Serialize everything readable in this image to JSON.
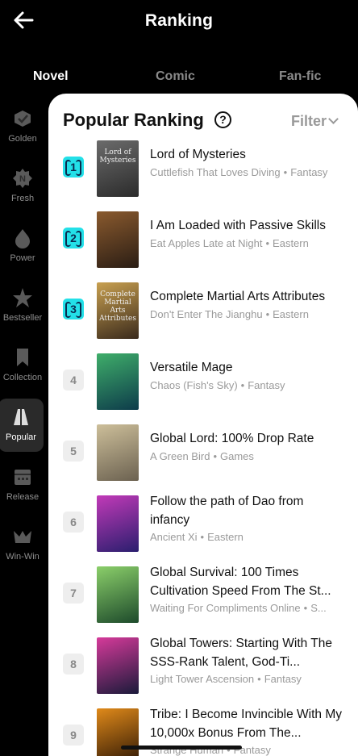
{
  "header": {
    "title": "Ranking"
  },
  "tabs": [
    {
      "label": "Novel",
      "active": true
    },
    {
      "label": "Comic",
      "active": false
    },
    {
      "label": "Fan-fic",
      "active": false
    }
  ],
  "sidebar": {
    "items": [
      {
        "label": "Golden",
        "icon": "golden-icon"
      },
      {
        "label": "Fresh",
        "icon": "fresh-icon"
      },
      {
        "label": "Power",
        "icon": "power-icon"
      },
      {
        "label": "Bestseller",
        "icon": "bestseller-icon"
      },
      {
        "label": "Collection",
        "icon": "collection-icon"
      },
      {
        "label": "Popular",
        "icon": "popular-icon",
        "active": true
      },
      {
        "label": "Release",
        "icon": "release-icon"
      },
      {
        "label": "Win-Win",
        "icon": "win-win-icon"
      }
    ]
  },
  "panel": {
    "title": "Popular Ranking",
    "help_label": "?",
    "filter_label": "Filter"
  },
  "books": [
    {
      "rank": "1",
      "title": "Lord of Mysteries",
      "author": "Cuttlefish That Loves Diving",
      "genre": "Fantasy",
      "cover_text": "Lord of Mysteries",
      "cover_colors": [
        "#2b2b2b",
        "#6b6b6b"
      ]
    },
    {
      "rank": "2",
      "title": "I Am Loaded with Passive Skills",
      "author": "Eat Apples Late at Night",
      "genre": "Eastern",
      "cover_text": "",
      "cover_colors": [
        "#2a1d14",
        "#8a5a2e"
      ]
    },
    {
      "rank": "3",
      "title": "Complete Martial Arts Attributes",
      "author": "Don't Enter The Jianghu",
      "genre": "Eastern",
      "cover_text": "Complete Martial Arts Attributes",
      "cover_colors": [
        "#3a2a1c",
        "#c8a050"
      ]
    },
    {
      "rank": "4",
      "title": "Versatile Mage",
      "author": "Chaos (Fish's Sky)",
      "genre": "Fantasy",
      "cover_text": "",
      "cover_colors": [
        "#0d3b4a",
        "#3fae6a"
      ]
    },
    {
      "rank": "5",
      "title": "Global Lord: 100% Drop Rate",
      "author": "A Green Bird",
      "genre": "Games",
      "cover_text": "",
      "cover_colors": [
        "#6b6150",
        "#cdbf9a"
      ]
    },
    {
      "rank": "6",
      "title": "Follow the path of Dao from infancy",
      "author": "Ancient Xi",
      "genre": "Eastern",
      "cover_text": "",
      "cover_colors": [
        "#2a1e6e",
        "#c23ab8"
      ]
    },
    {
      "rank": "7",
      "title": "Global Survival: 100 Times Cultivation Speed From The St...",
      "author": "Waiting For Compliments Online",
      "genre": "S...",
      "cover_text": "",
      "cover_colors": [
        "#1d4a2b",
        "#8bcf6a"
      ]
    },
    {
      "rank": "8",
      "title": "Global Towers: Starting With The SSS-Rank Talent, God-Ti...",
      "author": "Light Tower Ascension",
      "genre": "Fantasy",
      "cover_text": "",
      "cover_colors": [
        "#1a1a3a",
        "#d63a9a"
      ]
    },
    {
      "rank": "9",
      "title": "Tribe: I Become Invincible With My 10,000x Bonus From The...",
      "author": "Strange Human",
      "genre": "Fantasy",
      "cover_text": "",
      "cover_colors": [
        "#2a1404",
        "#e08a1a"
      ]
    }
  ],
  "colors": {
    "accent": "#23e0e8",
    "background": "#000000",
    "panel": "#ffffff"
  }
}
